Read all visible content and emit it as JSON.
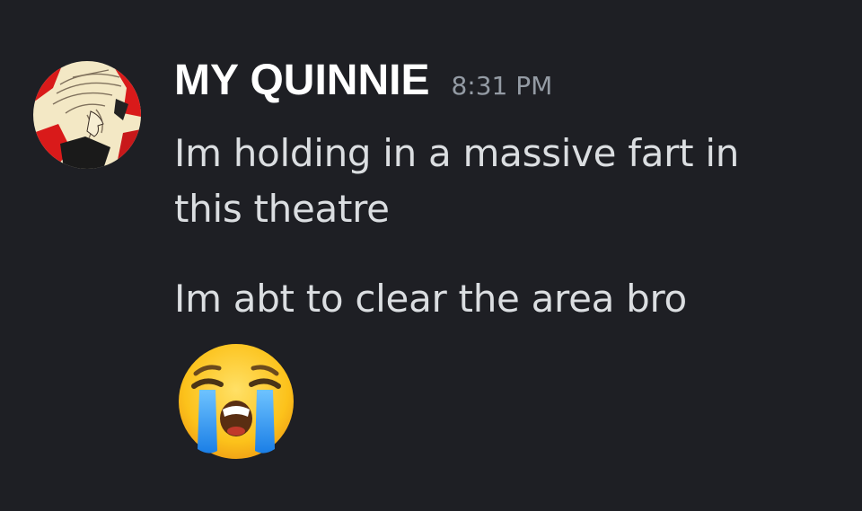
{
  "message": {
    "author": "MY QUINNIE",
    "timestamp": "8:31 PM",
    "lines": [
      [
        "Im holding in a massive fart in",
        "this theatre"
      ],
      "Im abt to clear the area bro"
    ],
    "emoji": "loudly-crying-face"
  },
  "colors": {
    "background": "#1e1f24",
    "username": "#ffffff",
    "timestamp": "#949ba4",
    "message_text": "#dbdee1"
  }
}
